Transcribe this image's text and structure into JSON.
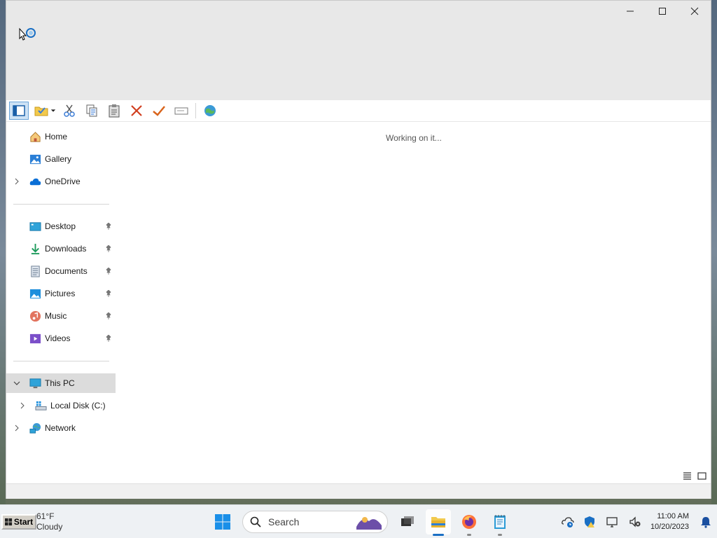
{
  "window": {
    "controls": {
      "minimize": "minimize",
      "maximize": "maximize",
      "close": "close"
    }
  },
  "toolbar": {
    "buttons": [
      "navigation-pane",
      "new-folder",
      "cut",
      "copy",
      "paste",
      "delete",
      "properties",
      "rename",
      "globe"
    ]
  },
  "nav": {
    "quick": [
      {
        "label": "Home",
        "icon": "home-icon"
      },
      {
        "label": "Gallery",
        "icon": "gallery-icon"
      },
      {
        "label": "OneDrive",
        "icon": "onedrive-icon"
      }
    ],
    "pinned": [
      {
        "label": "Desktop",
        "icon": "desktop-icon"
      },
      {
        "label": "Downloads",
        "icon": "downloads-icon"
      },
      {
        "label": "Documents",
        "icon": "documents-icon"
      },
      {
        "label": "Pictures",
        "icon": "pictures-icon"
      },
      {
        "label": "Music",
        "icon": "music-icon"
      },
      {
        "label": "Videos",
        "icon": "videos-icon"
      }
    ],
    "this_pc": "This PC",
    "local_disk": "Local Disk (C:)",
    "network": "Network"
  },
  "main": {
    "status": "Working on it..."
  },
  "taskbar": {
    "start_label": "Start",
    "weather_temp": "61°F",
    "weather_desc": "Cloudy",
    "search_label": "Search",
    "time": "11:00 AM",
    "date": "10/20/2023"
  },
  "colors": {
    "accent": "#1a6fc4",
    "selected_bg": "#dcdcdc",
    "window_chrome": "#e8e8e8"
  }
}
